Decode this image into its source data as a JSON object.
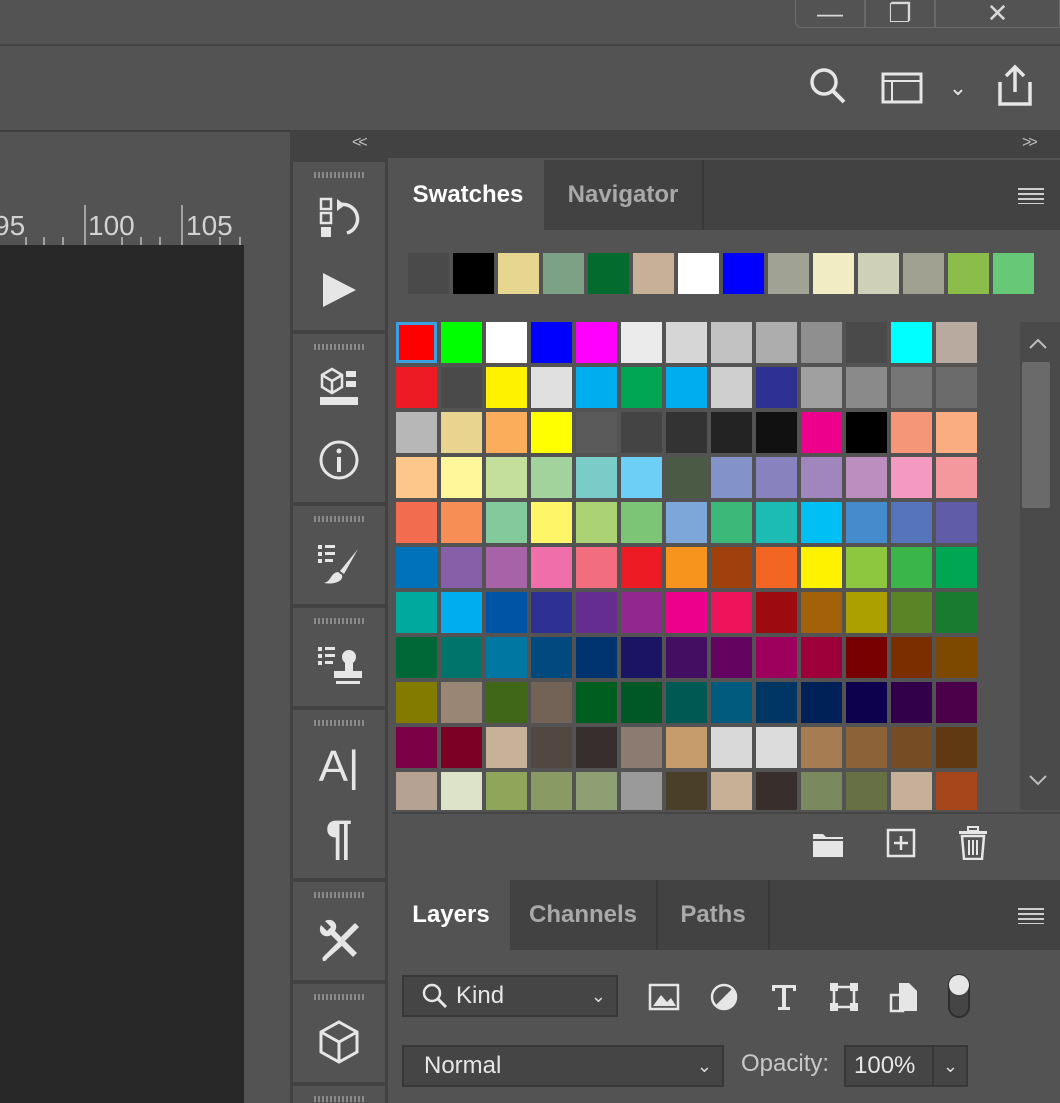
{
  "window": {
    "minimize_glyph": "—",
    "restore_glyph": "❐",
    "close_glyph": "✕"
  },
  "optionbar": {
    "search_icon": "search-icon",
    "workspace_icon": "workspace-icon",
    "chevron": "⌄",
    "share_icon": "share-icon"
  },
  "ruler": {
    "labels": [
      "95",
      "100",
      "105"
    ]
  },
  "collapse": {
    "left": "<<",
    "right": ">>"
  },
  "tools": [
    {
      "name": "history-icon"
    },
    {
      "name": "actions-play-icon"
    },
    {
      "name": "3d-materials-icon"
    },
    {
      "name": "info-icon"
    },
    {
      "name": "brush-settings-icon"
    },
    {
      "name": "clone-source-icon"
    },
    {
      "name": "character-icon",
      "glyph": "A|"
    },
    {
      "name": "paragraph-icon",
      "glyph": "¶"
    },
    {
      "name": "tool-presets-icon"
    },
    {
      "name": "3d-icon"
    }
  ],
  "swatches": {
    "tabs": [
      "Swatches",
      "Navigator"
    ],
    "active_tab": "Swatches",
    "recent": [
      "#4a4a4a",
      "#000000",
      "#e6d690",
      "#7da185",
      "#046b2e",
      "#c8b098",
      "#ffffff",
      "#0000ff",
      "#a0a293",
      "#f2ecc5",
      "#cfd0b8",
      "#a0a190",
      "#8bbd4a",
      "#67c878"
    ],
    "grid": [
      "#ff0000",
      "#00ff00",
      "#ffffff",
      "#0000ff",
      "#ff00ff",
      "#ebebeb",
      "#d6d6d6",
      "#c2c2c2",
      "#adadad",
      "#8f8f8f",
      "#4a4a4a",
      "#00ffff",
      "#b8aa9e",
      "#ed1c24",
      "#4a4a4a",
      "#fff200",
      "#e0e0e0",
      "#00aeef",
      "#00a651",
      "#00aeef",
      "#cfcfcf",
      "#2e3192",
      "#a0a0a0",
      "#8a8a8a",
      "#767676",
      "#6b6b6b",
      "#b7b7b7",
      "#e8d48e",
      "#fbad5c",
      "#ffff00",
      "#5a5a5a",
      "#444444",
      "#333333",
      "#232323",
      "#111111",
      "#ec008c",
      "#000000",
      "#f69679",
      "#f9ad81",
      "#fdc68a",
      "#fff799",
      "#c4df9b",
      "#a3d39c",
      "#7accc8",
      "#6dcff6",
      "#4a5a44",
      "#8393ca",
      "#8882be",
      "#a186be",
      "#bc8dbf",
      "#f49ac1",
      "#f5989d",
      "#f26c4f",
      "#f68e56",
      "#82ca9c",
      "#fff568",
      "#acd373",
      "#7cc576",
      "#7da7d9",
      "#3cb878",
      "#1cbbb4",
      "#00bff3",
      "#448ccb",
      "#5674b9",
      "#605ca8",
      "#0072bc",
      "#8560a8",
      "#a763a8",
      "#f06eaa",
      "#f26d7d",
      "#ed1c24",
      "#f7941d",
      "#a0410d",
      "#f26522",
      "#fff200",
      "#8dc63f",
      "#39b54a",
      "#00a651",
      "#00a99d",
      "#00aeef",
      "#0054a6",
      "#2e3192",
      "#662d91",
      "#92278f",
      "#ec008c",
      "#ed145b",
      "#9e0b0f",
      "#a36209",
      "#aba000",
      "#598527",
      "#197b30",
      "#006837",
      "#00746b",
      "#0076a3",
      "#004a80",
      "#003471",
      "#1b1464",
      "#440e62",
      "#630460",
      "#9e005d",
      "#9e0039",
      "#790000",
      "#7b2e00",
      "#7d4900",
      "#827b00",
      "#998675",
      "#406618",
      "#736357",
      "#005e20",
      "#005826",
      "#005952",
      "#005b7f",
      "#003663",
      "#002157",
      "#0d004c",
      "#32004b",
      "#4b0049",
      "#7b0046",
      "#7a0026",
      "#c7b299",
      "#534741",
      "#362f2d",
      "#8c7b70",
      "#c69c6d",
      "#d9d9d9",
      "#dcdcdc",
      "#a67c52",
      "#8c6239",
      "#754c24",
      "#603913",
      "#b5a293",
      "#dde3c8",
      "#8fa55a",
      "#8a9a64",
      "#8e9f73",
      "#9a9a9a",
      "#4a3f28",
      "#c8b097",
      "#382e2c",
      "#7b8a5e",
      "#667044",
      "#c7b09a",
      "#a8461b"
    ]
  },
  "layers": {
    "tabs": [
      "Layers",
      "Channels",
      "Paths"
    ],
    "active_tab": "Layers",
    "filter_kind": "Kind",
    "blend_mode": "Normal",
    "opacity_label": "Opacity:",
    "opacity_value": "100%"
  }
}
